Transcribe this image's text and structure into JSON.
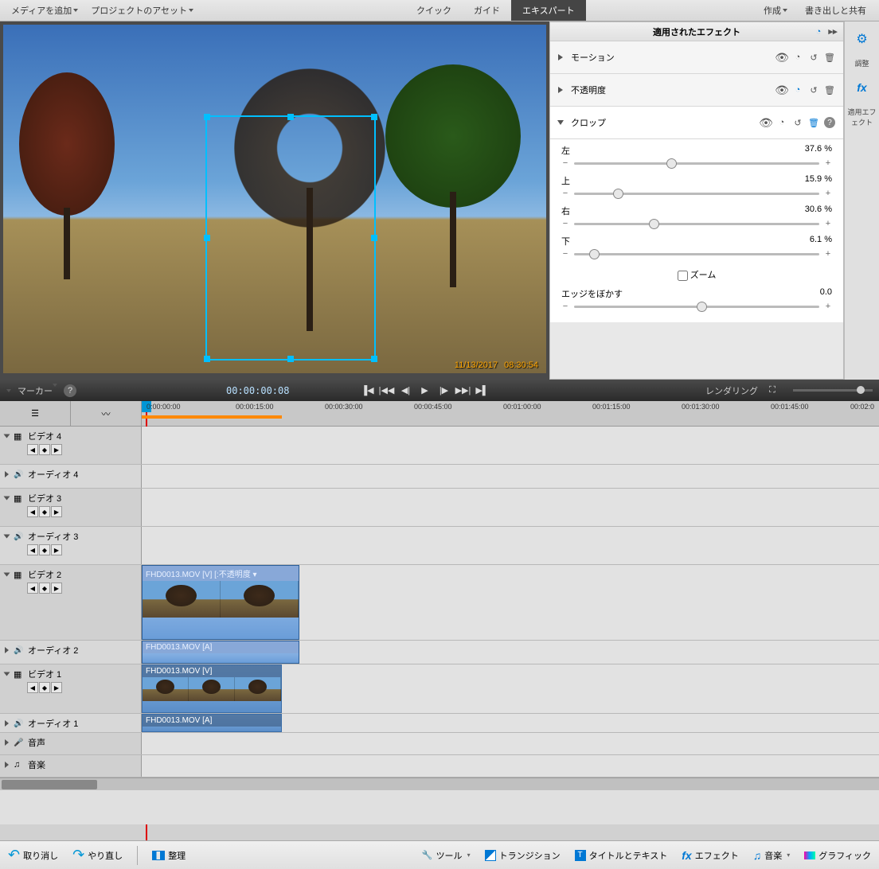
{
  "topmenu": {
    "addMedia": "メディアを追加",
    "projectAssets": "プロジェクトのアセット",
    "tabs": {
      "quick": "クイック",
      "guided": "ガイド",
      "expert": "エキスパート"
    },
    "create": "作成",
    "export": "書き出しと共有"
  },
  "preview": {
    "date": "11/13/2017",
    "time": "08:30:54"
  },
  "effects": {
    "title": "適用されたエフェクト",
    "motion": "モーション",
    "opacity": "不透明度",
    "crop": "クロップ",
    "sliders": {
      "left": {
        "label": "左",
        "value": "37.6 %",
        "pct": 37.6
      },
      "top": {
        "label": "上",
        "value": "15.9 %",
        "pct": 15.9
      },
      "right": {
        "label": "右",
        "value": "30.6 %",
        "pct": 30.6
      },
      "bottom": {
        "label": "下",
        "value": "6.1 %",
        "pct": 6.1
      },
      "edge": {
        "label": "エッジをぼかす",
        "value": "0.0",
        "pct": 50
      }
    },
    "zoom": "ズーム",
    "side": {
      "adjust": "調整",
      "fx": "適用エフェクト"
    }
  },
  "transport": {
    "marker": "マーカー",
    "timecode": "00:00:00:08",
    "render": "レンダリング"
  },
  "ruler": {
    "marks": [
      "0:00:00:00",
      "00:00:15:00",
      "00:00:30:00",
      "00:00:45:00",
      "00:01:00:00",
      "00:01:15:00",
      "00:01:30:00",
      "00:01:45:00",
      "00:02:0"
    ]
  },
  "tracks": {
    "v4": "ビデオ 4",
    "a4": "オーディオ 4",
    "v3": "ビデオ 3",
    "a3": "オーディオ 3",
    "v2": "ビデオ 2",
    "a2": "オーディオ 2",
    "v1": "ビデオ 1",
    "a1": "オーディオ 1",
    "voice": "音声",
    "music": "音楽"
  },
  "clips": {
    "v2": "FHD0013.MOV [V] [:不透明度 ▾",
    "a2": "FHD0013.MOV [A]",
    "v1": "FHD0013.MOV [V]",
    "a1": "FHD0013.MOV [A]"
  },
  "bottombar": {
    "undo": "取り消し",
    "redo": "やり直し",
    "organize": "整理",
    "tools": "ツール",
    "transitions": "トランジション",
    "titles": "タイトルとテキスト",
    "fx": "エフェクト",
    "music": "音楽",
    "graphics": "グラフィック"
  }
}
